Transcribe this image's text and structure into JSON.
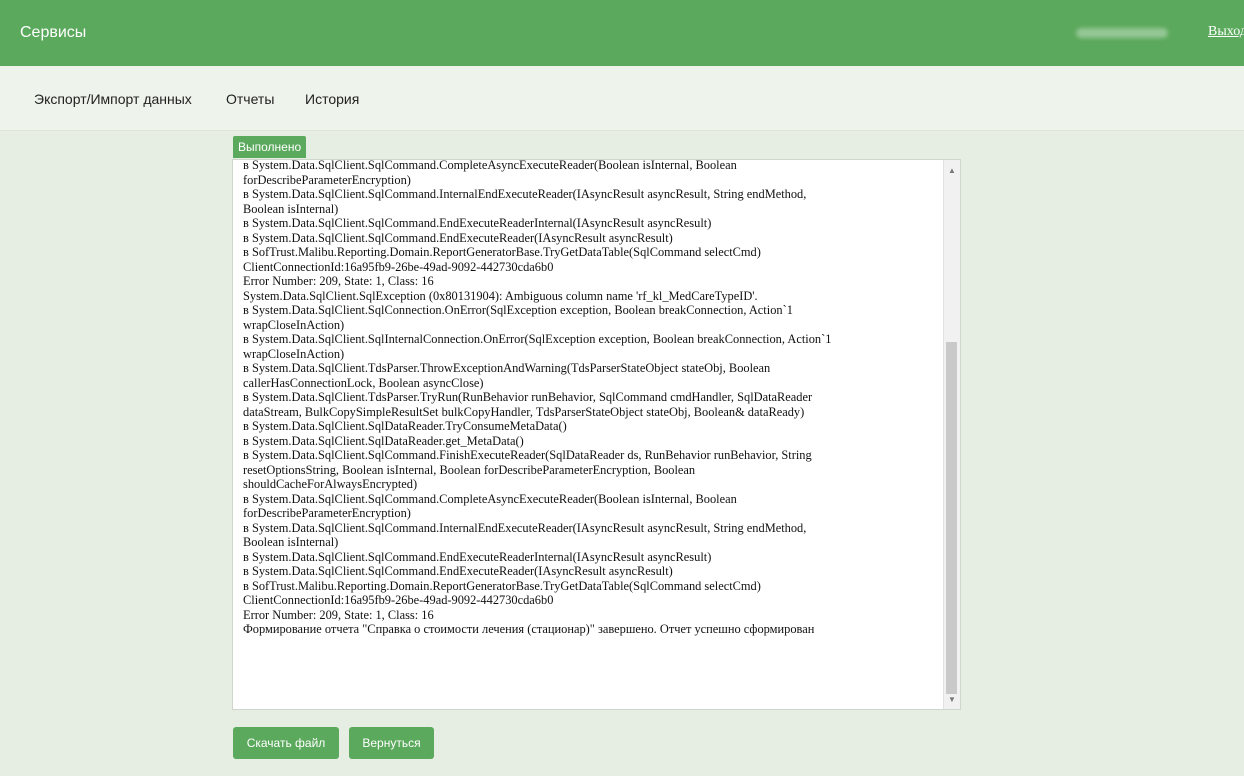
{
  "header": {
    "title": "Сервисы",
    "logout_label": "Выход"
  },
  "nav": {
    "items": [
      {
        "label": "Экспорт/Импорт данных"
      },
      {
        "label": "Отчеты"
      },
      {
        "label": "История"
      }
    ]
  },
  "status": {
    "badge": "Выполнено"
  },
  "log": {
    "lines": [
      "в System.Data.SqlClient.SqlCommand.CompleteAsyncExecuteReader(Boolean isInternal, Boolean",
      "forDescribeParameterEncryption)",
      "в System.Data.SqlClient.SqlCommand.InternalEndExecuteReader(IAsyncResult asyncResult, String endMethod,",
      "Boolean isInternal)",
      "в System.Data.SqlClient.SqlCommand.EndExecuteReaderInternal(IAsyncResult asyncResult)",
      "в System.Data.SqlClient.SqlCommand.EndExecuteReader(IAsyncResult asyncResult)",
      "в SofTrust.Malibu.Reporting.Domain.ReportGeneratorBase.TryGetDataTable(SqlCommand selectCmd)",
      "ClientConnectionId:16a95fb9-26be-49ad-9092-442730cda6b0",
      "Error Number: 209, State: 1, Class: 16",
      "System.Data.SqlClient.SqlException (0x80131904): Ambiguous column name 'rf_kl_MedCareTypeID'.",
      "в System.Data.SqlClient.SqlConnection.OnError(SqlException exception, Boolean breakConnection, Action`1",
      "wrapCloseInAction)",
      "в System.Data.SqlClient.SqlInternalConnection.OnError(SqlException exception, Boolean breakConnection, Action`1",
      "wrapCloseInAction)",
      "в System.Data.SqlClient.TdsParser.ThrowExceptionAndWarning(TdsParserStateObject stateObj, Boolean",
      "callerHasConnectionLock, Boolean asyncClose)",
      "в System.Data.SqlClient.TdsParser.TryRun(RunBehavior runBehavior, SqlCommand cmdHandler, SqlDataReader",
      "dataStream, BulkCopySimpleResultSet bulkCopyHandler, TdsParserStateObject stateObj, Boolean& dataReady)",
      "в System.Data.SqlClient.SqlDataReader.TryConsumeMetaData()",
      "в System.Data.SqlClient.SqlDataReader.get_MetaData()",
      "в System.Data.SqlClient.SqlCommand.FinishExecuteReader(SqlDataReader ds, RunBehavior runBehavior, String",
      "resetOptionsString, Boolean isInternal, Boolean forDescribeParameterEncryption, Boolean",
      "shouldCacheForAlwaysEncrypted)",
      "в System.Data.SqlClient.SqlCommand.CompleteAsyncExecuteReader(Boolean isInternal, Boolean",
      "forDescribeParameterEncryption)",
      "в System.Data.SqlClient.SqlCommand.InternalEndExecuteReader(IAsyncResult asyncResult, String endMethod,",
      "Boolean isInternal)",
      "в System.Data.SqlClient.SqlCommand.EndExecuteReaderInternal(IAsyncResult asyncResult)",
      "в System.Data.SqlClient.SqlCommand.EndExecuteReader(IAsyncResult asyncResult)",
      "в SofTrust.Malibu.Reporting.Domain.ReportGeneratorBase.TryGetDataTable(SqlCommand selectCmd)",
      "ClientConnectionId:16a95fb9-26be-49ad-9092-442730cda6b0",
      "Error Number: 209, State: 1, Class: 16",
      "Формирование отчета \"Справка о стоимости лечения (стационар)\" завершено. Отчет успешно сформирован"
    ]
  },
  "actions": {
    "download_label": "Скачать файл",
    "back_label": "Вернуться"
  }
}
